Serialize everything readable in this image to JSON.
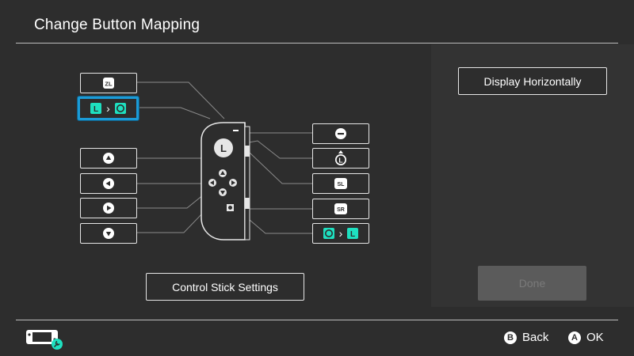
{
  "header": {
    "title": "Change Button Mapping"
  },
  "left_column": [
    {
      "id": "zl",
      "glyph": "ZL",
      "icon": "zl-button-icon",
      "selected": false
    },
    {
      "id": "l-remap",
      "from": "L",
      "to": "joystick-icon",
      "selected": true
    },
    {
      "id": "up",
      "icon": "up-arrow-button-icon"
    },
    {
      "id": "left",
      "icon": "left-arrow-button-icon"
    },
    {
      "id": "right",
      "icon": "right-arrow-button-icon"
    },
    {
      "id": "down",
      "icon": "down-arrow-button-icon"
    }
  ],
  "right_column": [
    {
      "id": "minus",
      "icon": "minus-button-icon"
    },
    {
      "id": "stick-press",
      "icon": "stick-press-icon",
      "glyph": "L"
    },
    {
      "id": "sl",
      "glyph": "SL",
      "icon": "sl-button-icon"
    },
    {
      "id": "sr",
      "glyph": "SR",
      "icon": "sr-button-icon"
    },
    {
      "id": "capture-remap",
      "from": "capture-icon",
      "to": "L",
      "selected": false
    }
  ],
  "joycon": {
    "stick_label": "L"
  },
  "controls": {
    "control_stick_settings": "Control Stick Settings",
    "display_horizontally": "Display Horizontally",
    "done": "Done"
  },
  "footer": {
    "back_button_glyph": "B",
    "back_label": "Back",
    "ok_button_glyph": "A",
    "ok_label": "OK",
    "console_icon": "console-settings-icon"
  },
  "colors": {
    "background": "#2d2d2d",
    "accent_teal": "#1ee0c0",
    "selection_blue": "#1b9bd7",
    "done_disabled": "#5b5b5b"
  }
}
